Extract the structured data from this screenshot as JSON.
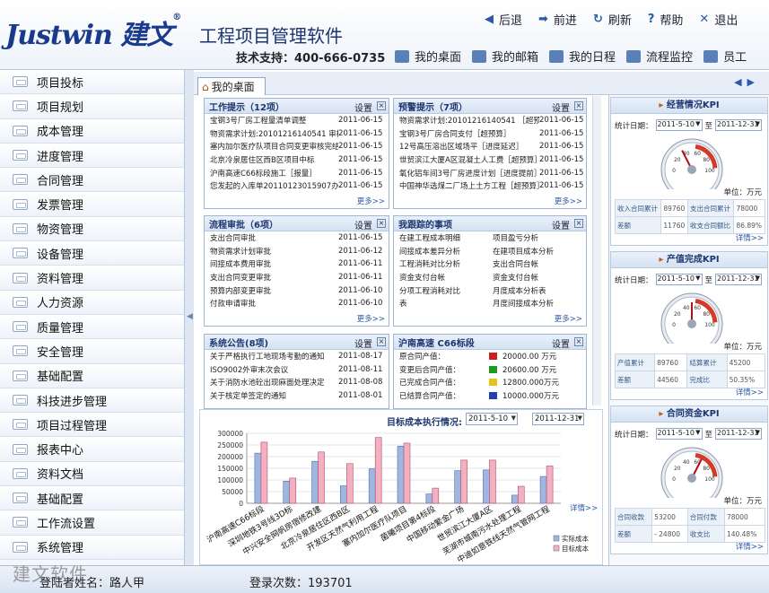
{
  "header": {
    "logo": "Justwin",
    "logo_cn": "建文",
    "logo_mark": "®",
    "app_title": "工程项目管理软件",
    "top_links": [
      {
        "icon": "back-arrow-icon",
        "label": "后退"
      },
      {
        "icon": "forward-arrow-icon",
        "label": "前进"
      },
      {
        "icon": "refresh-icon",
        "label": "刷新"
      },
      {
        "icon": "help-icon",
        "label": "帮助"
      },
      {
        "icon": "close-icon",
        "label": "退出"
      }
    ],
    "support": "技术支持：400-666-0735",
    "nav_links": [
      {
        "icon": "desktop-icon",
        "label": "我的桌面"
      },
      {
        "icon": "mailbox-icon",
        "label": "我的邮箱"
      },
      {
        "icon": "calendar-icon",
        "label": "我的日程"
      },
      {
        "icon": "flow-monitor-icon",
        "label": "流程监控"
      },
      {
        "icon": "employee-icon",
        "label": "员工"
      }
    ]
  },
  "sidebar": {
    "items": [
      "项目投标",
      "项目规划",
      "成本管理",
      "进度管理",
      "合同管理",
      "发票管理",
      "物资管理",
      "设备管理",
      "资料管理",
      "人力资源",
      "质量管理",
      "安全管理",
      "基础配置",
      "科技进步管理",
      "项目过程管理",
      "报表中心",
      "资料文档",
      "基础配置",
      "工作流设置",
      "系统管理"
    ]
  },
  "tabs": {
    "desktop": "我的桌面",
    "home_glyph": "⌂"
  },
  "panels": {
    "settings": "设置",
    "close_glyph": "×",
    "more": "更多>>",
    "work": {
      "title": "工作提示（12项）",
      "rows": [
        {
          "t": "宝钢3号厂房工程量清单调整",
          "d": "2011-06-15"
        },
        {
          "t": "物资需求计划:20101216140541 审核完结",
          "d": "2011-06-15"
        },
        {
          "t": "塞内加尔医疗队项目合同变更审核完结",
          "d": "2011-06-15"
        },
        {
          "t": "北京冷泉居住区西B区项目中标",
          "d": "2011-06-15"
        },
        {
          "t": "沪南高速C66标段施工［报量］",
          "d": "2011-06-15"
        },
        {
          "t": "您发起的入库单20110123015907办理",
          "d": "2011-06-15"
        }
      ]
    },
    "alert": {
      "title": "预警提示（7项）",
      "rows": [
        {
          "t": "物资需求计划:20101216140541 ［超预算］",
          "d": "2011-06-15"
        },
        {
          "t": "宝钢3号厂房合同支付［超预算］",
          "d": "2011-06-15"
        },
        {
          "t": "12号高压溶出区域场平［进度延迟］",
          "d": "2011-06-15"
        },
        {
          "t": "世贸滨江大厦A区混凝土人工费［超预算］",
          "d": "2011-06-15"
        },
        {
          "t": "氧化铝车间3号厂房进度计划［进度提前］",
          "d": "2011-06-15"
        },
        {
          "t": "中国神华选煤二厂场上土方工程［超预算］",
          "d": "2011-06-15"
        }
      ]
    },
    "flow": {
      "title": "流程审批（6项）",
      "rows": [
        {
          "t": "支出合同审批",
          "d": "2011-06-15"
        },
        {
          "t": "物资需求计划审批",
          "d": "2011-06-12"
        },
        {
          "t": "间接成本费用审批",
          "d": "2011-06-11"
        },
        {
          "t": "支出合同变更审批",
          "d": "2011-06-11"
        },
        {
          "t": "预算内部变更审批",
          "d": "2011-06-10"
        },
        {
          "t": "付款申请审批",
          "d": "2011-06-10"
        }
      ]
    },
    "track": {
      "title": "我跟踪的事项",
      "rows": [
        [
          "在建工程成本明细",
          "项目盈亏分析"
        ],
        [
          "间接成本差异分析",
          "在建项目成本分析"
        ],
        [
          "工程消耗对比分析",
          "支出合同台帐"
        ],
        [
          "资金支付台帐",
          "资金支付台帐"
        ],
        [
          "分项工程消耗对比",
          "月度成本分析表"
        ],
        [
          "表",
          "月度间接成本分析"
        ]
      ]
    },
    "notice": {
      "title": "系统公告(8项)",
      "rows": [
        {
          "t": "关于严格执行工地现场考勤的通知",
          "d": "2011-08-17"
        },
        {
          "t": "ISO9002外审末次会议",
          "d": "2011-08-11"
        },
        {
          "t": "关于消防水池砼出现麻面处理决定",
          "d": "2011-08-08"
        },
        {
          "t": "关于核定单签定的通知",
          "d": "2011-08-01"
        }
      ]
    },
    "c66": {
      "title": "沪南高速 C66标段",
      "rows": [
        {
          "t": "原合同产值：",
          "v": "20000.00 万元",
          "color": "#cc1f1f"
        },
        {
          "t": "变更后合同产值：",
          "v": "20600.00 万元",
          "color": "#1f9a1f"
        },
        {
          "t": "已完成合同产值：",
          "v": "12800.000万元",
          "color": "#e8c21a"
        },
        {
          "t": "已结算合同产值：",
          "v": "10000.000万元",
          "color": "#1f3fb0"
        }
      ]
    }
  },
  "chart": {
    "title": "目标成本执行情况:",
    "from": "2011-5-10",
    "to": "2011-12-31",
    "more": "详情>>"
  },
  "chart_data": {
    "type": "bar",
    "title": "目标成本执行情况",
    "categories": [
      "沪南高速C66标段",
      "深圳地铁3号线3D标",
      "中兴安全网帆房宿修改建",
      "北京冷泉居住区西B区",
      "开发区天然气利用工程",
      "塞内加尔医疗队项目",
      "菌曦项目第4标段",
      "中国移动繁金广场",
      "世贸滨江大厦A区",
      "芜湖市城南污水处理工程",
      "中迪如意铁线天然气管网工程"
    ],
    "series": [
      {
        "name": "实际成本",
        "values": [
          215000,
          95000,
          180000,
          75000,
          148000,
          245000,
          40000,
          140000,
          143000,
          35000,
          115000
        ]
      },
      {
        "name": "目标成本",
        "values": [
          262000,
          108000,
          220000,
          170000,
          282000,
          258000,
          65000,
          185000,
          185000,
          73000,
          160000
        ]
      }
    ],
    "ylim": [
      0,
      300000
    ],
    "yticks": [
      0,
      50000,
      100000,
      150000,
      200000,
      250000,
      300000
    ],
    "colors": [
      "#9fb6e0",
      "#f2b0c0"
    ],
    "legend_position": "bottom-right"
  },
  "kpis": [
    {
      "title": "经营情况KPI",
      "label": "统计日期：",
      "from": "2011-5-10",
      "to": "2011-12-31",
      "sep": "至",
      "unit": "单位：万元",
      "value": 35,
      "cells": [
        [
          "收入合同累计",
          "89760",
          "支出合同累计",
          "78000"
        ],
        [
          "差额",
          "11760",
          "收支合同额比",
          "86.89%"
        ]
      ],
      "more": "详情>>"
    },
    {
      "title": "产值完成KPI",
      "label": "统计日期：",
      "from": "2011-5-10",
      "to": "2011-12-31",
      "sep": "至",
      "unit": "单位：万元",
      "value": 50,
      "cells": [
        [
          "产值累计",
          "89760",
          "结算累计",
          "45200"
        ],
        [
          "差额",
          "44560",
          "完成比",
          "50.35%"
        ]
      ],
      "more": "详情>>"
    },
    {
      "title": "合同资金KPI",
      "label": "统计日期：",
      "from": "2011-5-10",
      "to": "2011-12-31",
      "sep": "至",
      "unit": "单位：万元",
      "value": 65,
      "cells": [
        [
          "合同收款",
          "53200",
          "合同付款",
          "78000"
        ],
        [
          "差额",
          "- 24800",
          "收支比",
          "140.48%"
        ]
      ],
      "more": "详情>>"
    }
  ],
  "gauge_ticks": [
    "0",
    "20",
    "40",
    "60",
    "80",
    "100"
  ],
  "status": {
    "user": "登陆者姓名：路人甲",
    "count": "登录次数：193701"
  },
  "watermark": "建文软件"
}
